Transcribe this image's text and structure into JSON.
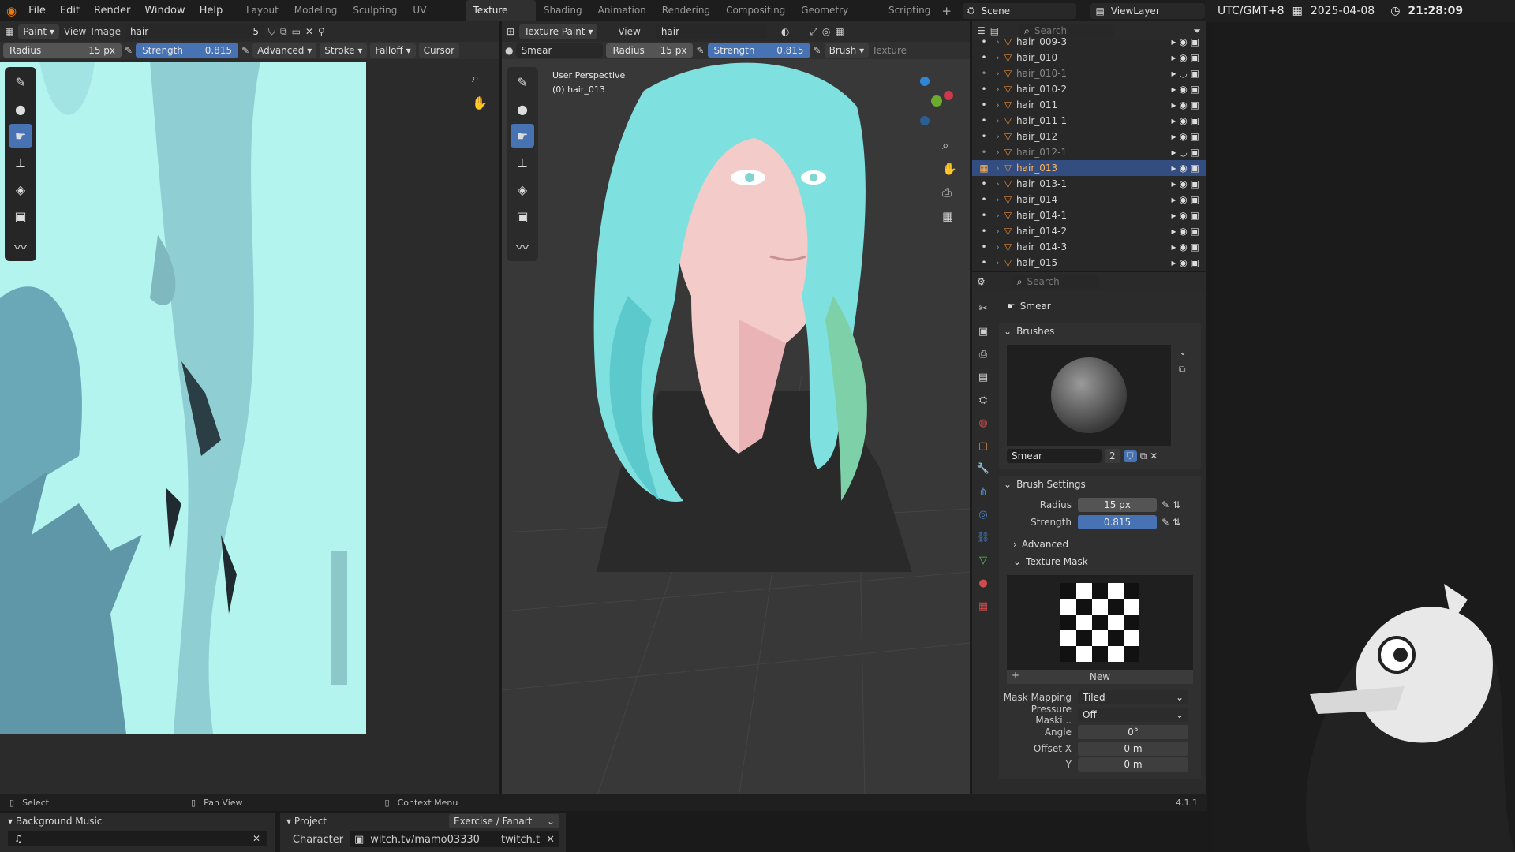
{
  "menus": [
    "File",
    "Edit",
    "Render",
    "Window",
    "Help"
  ],
  "workspaces": [
    "Layout",
    "Modeling",
    "Sculpting",
    "UV Editing",
    "Texture Paint",
    "Shading",
    "Animation",
    "Rendering",
    "Compositing",
    "Geometry Nodes",
    "Scripting"
  ],
  "scene": {
    "label": "Scene",
    "view_layer": "ViewLayer"
  },
  "clock": {
    "tz": "UTC/GMT+8",
    "date": "2025-04-08",
    "time": "21:28:09"
  },
  "image_editor": {
    "mode": "Paint",
    "view": "View",
    "image": "Image",
    "image_name": "hair",
    "user_count": "5",
    "radius_label": "Radius",
    "radius_value": "15 px",
    "strength_label": "Strength",
    "strength_value": "0.815",
    "advanced": "Advanced",
    "stroke": "Stroke",
    "falloff": "Falloff",
    "cursor": "Cursor",
    "accent": "#b3f4ef"
  },
  "viewport": {
    "mode": "Texture Paint",
    "view": "View",
    "image_name": "hair",
    "brush_name": "Smear",
    "radius_label": "Radius",
    "radius_value": "15 px",
    "strength_label": "Strength",
    "strength_value": "0.815",
    "brush": "Brush",
    "texture": "Texture",
    "perspective": "User Perspective",
    "object": "(0) hair_013"
  },
  "outliner": {
    "search": "Search",
    "items": [
      {
        "name": "hair_009-3"
      },
      {
        "name": "hair_010"
      },
      {
        "name": "hair_010-1"
      },
      {
        "name": "hair_010-2"
      },
      {
        "name": "hair_011"
      },
      {
        "name": "hair_011-1"
      },
      {
        "name": "hair_012"
      },
      {
        "name": "hair_012-1"
      },
      {
        "name": "hair_013"
      },
      {
        "name": "hair_013-1"
      },
      {
        "name": "hair_014"
      },
      {
        "name": "hair_014-1"
      },
      {
        "name": "hair_014-2"
      },
      {
        "name": "hair_014-3"
      },
      {
        "name": "hair_015"
      }
    ]
  },
  "properties": {
    "search": "Search",
    "brush_title": "Smear",
    "brushes_header": "Brushes",
    "brush_name": "Smear",
    "brush_users": "2",
    "brush_settings": "Brush Settings",
    "radius_label": "Radius",
    "radius_value": "15 px",
    "strength_label": "Strength",
    "strength_value": "0.815",
    "advanced": "Advanced",
    "texture_mask": "Texture Mask",
    "new_label": "New",
    "mask_mapping_label": "Mask Mapping",
    "mask_mapping_value": "Tiled",
    "pressure_label": "Pressure Maski...",
    "pressure_value": "Off",
    "angle_label": "Angle",
    "angle_value": "0°",
    "offset_x_label": "Offset X",
    "offset_x_value": "0 m",
    "y_label": "Y",
    "y_value": "0 m",
    "version": "4.1.1"
  },
  "statusbar": {
    "select": "Select",
    "pan": "Pan View",
    "context": "Context Menu"
  },
  "overlay": {
    "bg_music_title": "Background Music",
    "project_title": "Project",
    "project_value": "Exercise / Fanart",
    "character_label": "Character",
    "character_value": "witch.tv/mamo03330",
    "character_extra": "twitch.t"
  }
}
